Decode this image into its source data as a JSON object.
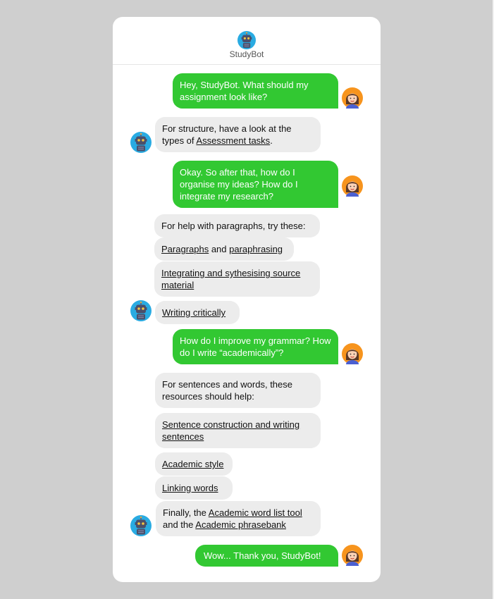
{
  "header": {
    "title": "StudyBot",
    "bot_icon": "robot-icon"
  },
  "messages": {
    "m1": "Hey, StudyBot. What should my assignment look like?",
    "r1": {
      "pre": "For structure, have a look at the types of ",
      "link": "Assessment tasks",
      "post": "."
    },
    "m2": "Okay. So after that, how do I organise my ideas? How do I integrate my research?",
    "r2": {
      "intro": "For help with paragraphs, try these:",
      "link_a": "Paragraphs",
      "and": " and ",
      "link_b": "paraphrasing",
      "link_c": "Integrating and sythesising source material",
      "link_d": "Writing critically"
    },
    "m3": "How do I improve my grammar? How do I write “academically”?",
    "r3": {
      "intro": "For sentences and words, these resources should help:",
      "link_a": "Sentence construction and writing sentences",
      "link_b": "Academic style",
      "link_c": "Linking words",
      "final_pre": "Finally, the ",
      "final_link1": "Academic word list tool",
      "final_mid": " and the ",
      "final_link2": "Academic phrasebank"
    },
    "m4": "Wow... Thank you, StudyBot!"
  },
  "colors": {
    "user_bubble": "#32c832",
    "bot_bubble": "#ececec",
    "bot_avatar_bg": "#29abe2",
    "user_avatar_bg": "#f7941d"
  }
}
